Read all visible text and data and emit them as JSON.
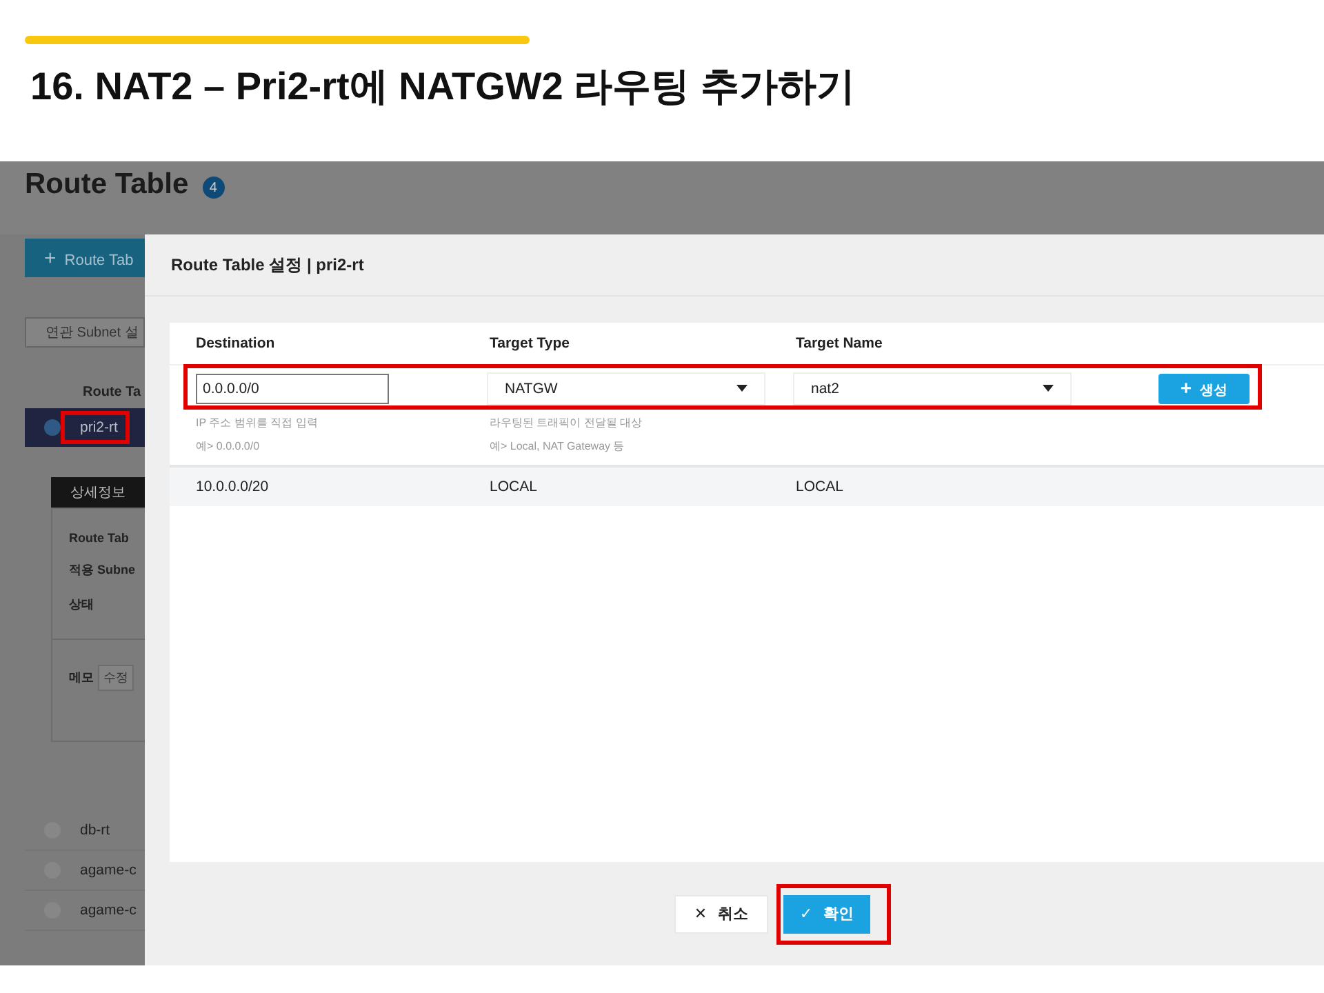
{
  "slide": {
    "title": "16. NAT2 – Pri2-rt에 NATGW2 라우팅 추가하기"
  },
  "page": {
    "heading": "Route Table",
    "count": "4",
    "create_icon": "+",
    "create_button": "Route Tab",
    "subnet_button": "연관 Subnet 설",
    "column_header": "Route Ta",
    "route_tables": [
      {
        "name": "pri2-rt",
        "selected": true,
        "highlighted": true
      },
      {
        "name": "db-rt",
        "selected": false,
        "highlighted": false
      },
      {
        "name": "agame-c",
        "selected": false,
        "highlighted": false
      },
      {
        "name": "agame-c",
        "selected": false,
        "highlighted": false
      }
    ],
    "detail_tab": "상세정보",
    "detail_labels": [
      "Route Tab",
      "적용 Subne",
      "상태"
    ],
    "memo_label": "메모",
    "memo_button": "수정"
  },
  "dialog": {
    "title": "Route Table 설정 | pri2-rt",
    "columns": [
      "Destination",
      "Target Type",
      "Target Name"
    ],
    "new_route": {
      "highlighted": true,
      "destination": "0.0.0.0/0",
      "destination_hints": [
        "IP 주소 범위를 직접 입력",
        "예> 0.0.0.0/0"
      ],
      "target_type": "NATGW",
      "target_type_hints": [
        "라우팅된 트래픽이 전달될 대상",
        "예> Local, NAT Gateway 등"
      ],
      "target_name": "nat2",
      "add_icon": "+",
      "add_button": "생성"
    },
    "routes": [
      {
        "destination": "10.0.0.0/20",
        "target_type": "LOCAL",
        "target_name": "LOCAL"
      }
    ],
    "cancel_icon": "✕",
    "cancel_button": "취소",
    "confirm_icon": "✓",
    "confirm_button": "확인",
    "confirm_highlighted": true
  }
}
